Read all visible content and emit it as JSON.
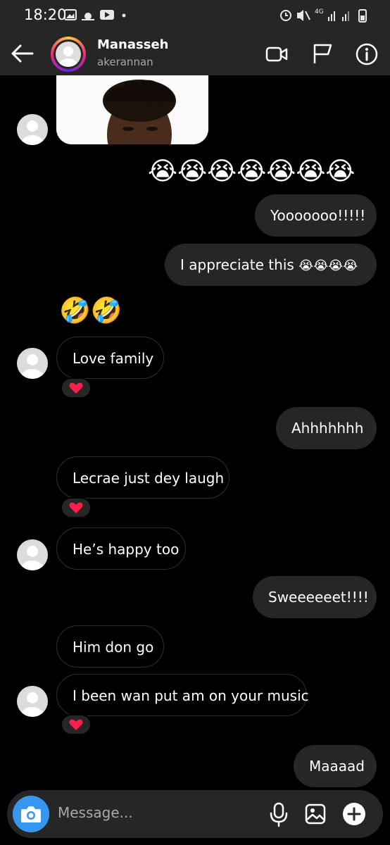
{
  "status_bar": {
    "time": "18:20",
    "network": "4G"
  },
  "header": {
    "name": "Manasseh",
    "username": "akerannan"
  },
  "messages": {
    "crying_emoji_row": "😭😭😭😭😭😭😭",
    "m1": "Yooooooo!!!!!",
    "m2_text": "I appreciate this",
    "m2_emoji": "😭😭😭😭",
    "laugh_emoji_row": "🤣🤣",
    "m3": "Love family",
    "m4": "Ahhhhhhh",
    "m5": "Lecrae just dey laugh",
    "m6": "He’s happy too",
    "m7": "Sweeeeeet!!!!",
    "m8": "Him don go",
    "m9": "I been wan put am on your music",
    "m10": "Maaaad",
    "reaction": "❤️"
  },
  "composer": {
    "placeholder": "Message..."
  },
  "colors": {
    "bar": "#262626",
    "accent": "#3797f0",
    "outgoing": "#262626"
  }
}
